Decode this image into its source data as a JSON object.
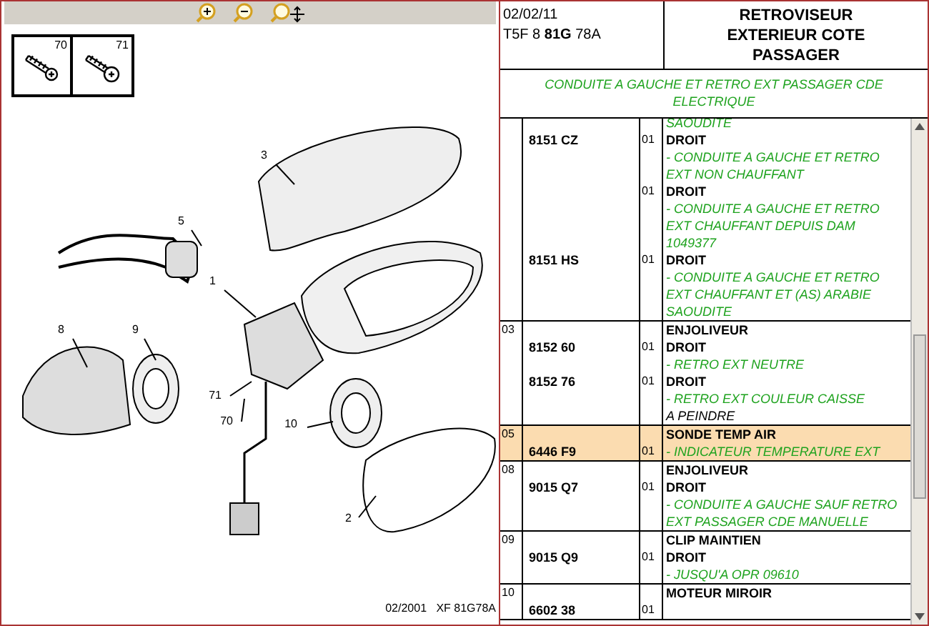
{
  "diagram": {
    "fixings": [
      {
        "label": "70"
      },
      {
        "label": "71"
      }
    ],
    "callouts": [
      {
        "label": "3"
      },
      {
        "label": "5"
      },
      {
        "label": "1"
      },
      {
        "label": "8"
      },
      {
        "label": "9"
      },
      {
        "label": "71"
      },
      {
        "label": "70"
      },
      {
        "label": "10"
      },
      {
        "label": "2"
      }
    ],
    "footer": "02/2001   XF 81G78A"
  },
  "header": {
    "date": "02/02/11",
    "code": "T5F 8 **81G** 78A",
    "title": "RETROVISEUR EXTERIEUR COTE PASSAGER",
    "subtitle": "CONDUITE A GAUCHE ET RETRO EXT PASSAGER CDE ELECTRIQUE"
  },
  "groups": [
    {
      "selected": false,
      "lines": [
        {
          "kind": "note",
          "text": "SAOUDITE"
        },
        {
          "part": "8151 CZ",
          "qty": "01",
          "kind": "name",
          "text": "DROIT"
        },
        {
          "kind": "note",
          "text": "- CONDUITE A GAUCHE ET RETRO EXT NON CHAUFFANT"
        },
        {
          "qty": "01",
          "kind": "name",
          "text": "DROIT"
        },
        {
          "kind": "note",
          "text": "- CONDUITE A GAUCHE ET RETRO EXT CHAUFFANT DEPUIS DAM 1049377"
        },
        {
          "part": "8151 HS",
          "qty": "01",
          "kind": "name",
          "text": "DROIT"
        },
        {
          "kind": "note",
          "text": "- CONDUITE A GAUCHE ET RETRO EXT CHAUFFANT ET (AS) ARABIE SAOUDITE"
        }
      ]
    },
    {
      "ref": "03",
      "selected": false,
      "lines": [
        {
          "kind": "name",
          "text": "ENJOLIVEUR"
        },
        {
          "part": "8152 60",
          "qty": "01",
          "kind": "name",
          "text": "DROIT"
        },
        {
          "kind": "note",
          "text": "- RETRO EXT NEUTRE"
        },
        {
          "part": "8152 76",
          "qty": "01",
          "kind": "name",
          "text": "DROIT"
        },
        {
          "kind": "note",
          "text": "- RETRO EXT COULEUR CAISSE"
        },
        {
          "kind": "remark",
          "text": "A PEINDRE"
        }
      ]
    },
    {
      "ref": "05",
      "selected": true,
      "lines": [
        {
          "kind": "name",
          "text": "SONDE TEMP AIR"
        },
        {
          "part": "6446 F9",
          "qty": "01",
          "kind": "note",
          "text": "- INDICATEUR TEMPERATURE EXT"
        }
      ]
    },
    {
      "ref": "08",
      "selected": false,
      "lines": [
        {
          "kind": "name",
          "text": "ENJOLIVEUR"
        },
        {
          "part": "9015 Q7",
          "qty": "01",
          "kind": "name",
          "text": "DROIT"
        },
        {
          "kind": "note",
          "text": "- CONDUITE A GAUCHE SAUF RETRO EXT PASSAGER CDE MANUELLE"
        }
      ]
    },
    {
      "ref": "09",
      "selected": false,
      "lines": [
        {
          "kind": "name",
          "text": "CLIP MAINTIEN"
        },
        {
          "part": "9015 Q9",
          "qty": "01",
          "kind": "name",
          "text": "DROIT"
        },
        {
          "kind": "note",
          "text": "- JUSQU'A OPR 09610"
        }
      ]
    },
    {
      "ref": "10",
      "selected": false,
      "lines": [
        {
          "kind": "name",
          "text": "MOTEUR MIROIR"
        },
        {
          "part": "6602 38",
          "qty": "01"
        }
      ]
    }
  ]
}
